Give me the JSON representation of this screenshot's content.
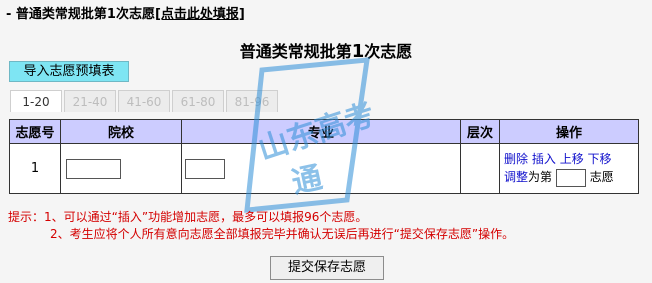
{
  "top_link": {
    "prefix": "- 普通类常规批第1次志愿",
    "link": "[点击此处填报]"
  },
  "title": {
    "pre": "普通类常规批第",
    "num": "1",
    "post": "次志愿"
  },
  "import_button": "导入志愿预填表",
  "tabs": [
    "1-20",
    "21-40",
    "41-60",
    "61-80",
    "81-96"
  ],
  "active_tab": 0,
  "table": {
    "headers": [
      "志愿号",
      "院校",
      "专业",
      "层次",
      "操作"
    ],
    "row": {
      "num": "1",
      "ops": {
        "delete": "删除",
        "insert": "插入",
        "up": "上移",
        "down": "下移",
        "adjust": "调整",
        "mid": "为第",
        "end": "志愿"
      }
    }
  },
  "watermark": {
    "line1": "山东高考",
    "line2": "通"
  },
  "tips": {
    "line1": "提示：1、可以通过“插入”功能增加志愿，最多可以填报96个志愿。",
    "line2": "2、考生应将个人所有意向志愿全部填报完毕并确认无误后再进行“提交保存志愿”操作。"
  },
  "submit_button": "提交保存志愿",
  "colors": {
    "header_bg": "#ccccff",
    "import_bg": "#7ee5f3",
    "tip_color": "#d40000",
    "link_color": "#1010cc",
    "watermark": "#2f8fd8"
  }
}
